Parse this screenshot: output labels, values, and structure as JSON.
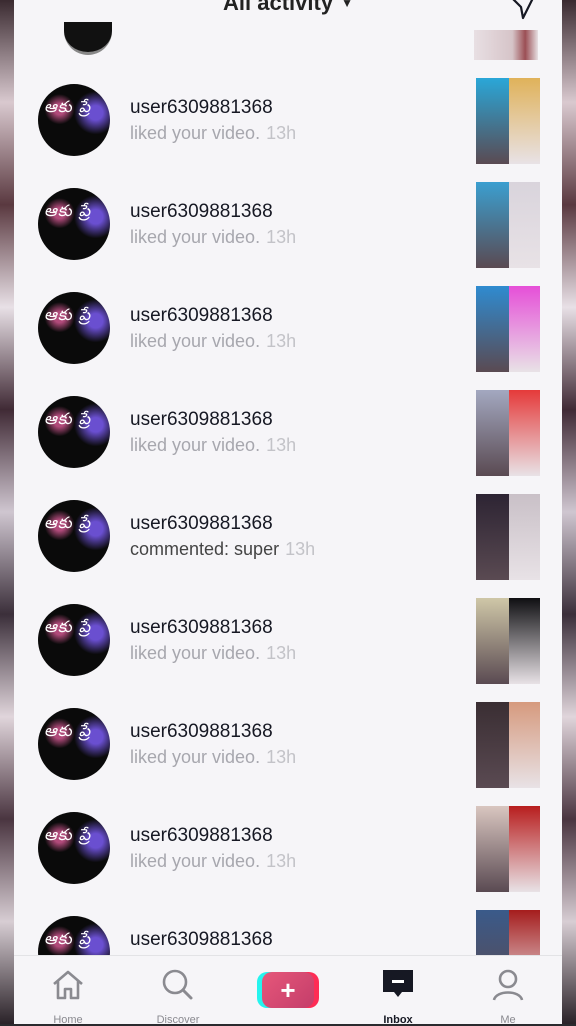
{
  "header": {
    "title": "All activity",
    "caret": "▼"
  },
  "notifications": [
    {
      "username": "user6309881368",
      "text": "liked your video.",
      "time": "13h",
      "type": "like",
      "thumb": [
        "#2aa7d8",
        "#e0b25a"
      ]
    },
    {
      "username": "user6309881368",
      "text": "liked your video.",
      "time": "13h",
      "type": "like",
      "thumb": [
        "#3b9fd0",
        "#d9d4dc"
      ]
    },
    {
      "username": "user6309881368",
      "text": "liked your video.",
      "time": "13h",
      "type": "like",
      "thumb": [
        "#2f8bd0",
        "#e64fd8"
      ]
    },
    {
      "username": "user6309881368",
      "text": "liked your video.",
      "time": "13h",
      "type": "like",
      "thumb": [
        "#a3a8c0",
        "#e53a3a"
      ]
    },
    {
      "username": "user6309881368",
      "text": "commented: super",
      "time": "13h",
      "type": "comment",
      "thumb": [
        "#2d2433",
        "#c9c0c7"
      ]
    },
    {
      "username": "user6309881368",
      "text": "liked your video.",
      "time": "13h",
      "type": "like",
      "thumb": [
        "#cfc7a8",
        "#0f0f12"
      ]
    },
    {
      "username": "user6309881368",
      "text": "liked your video.",
      "time": "13h",
      "type": "like",
      "thumb": [
        "#3a2e33",
        "#d69a7e"
      ]
    },
    {
      "username": "user6309881368",
      "text": "liked your video.",
      "time": "13h",
      "type": "like",
      "thumb": [
        "#d9c6c0",
        "#b81e1e"
      ]
    },
    {
      "username": "user6309881368",
      "text": "",
      "time": "",
      "type": "like",
      "thumb": [
        "#3a5a8a",
        "#a51d1d"
      ]
    }
  ],
  "nav": {
    "home": "Home",
    "discover": "Discover",
    "inbox": "Inbox",
    "me": "Me"
  },
  "avatar_text": "ఆకు ప్రే"
}
